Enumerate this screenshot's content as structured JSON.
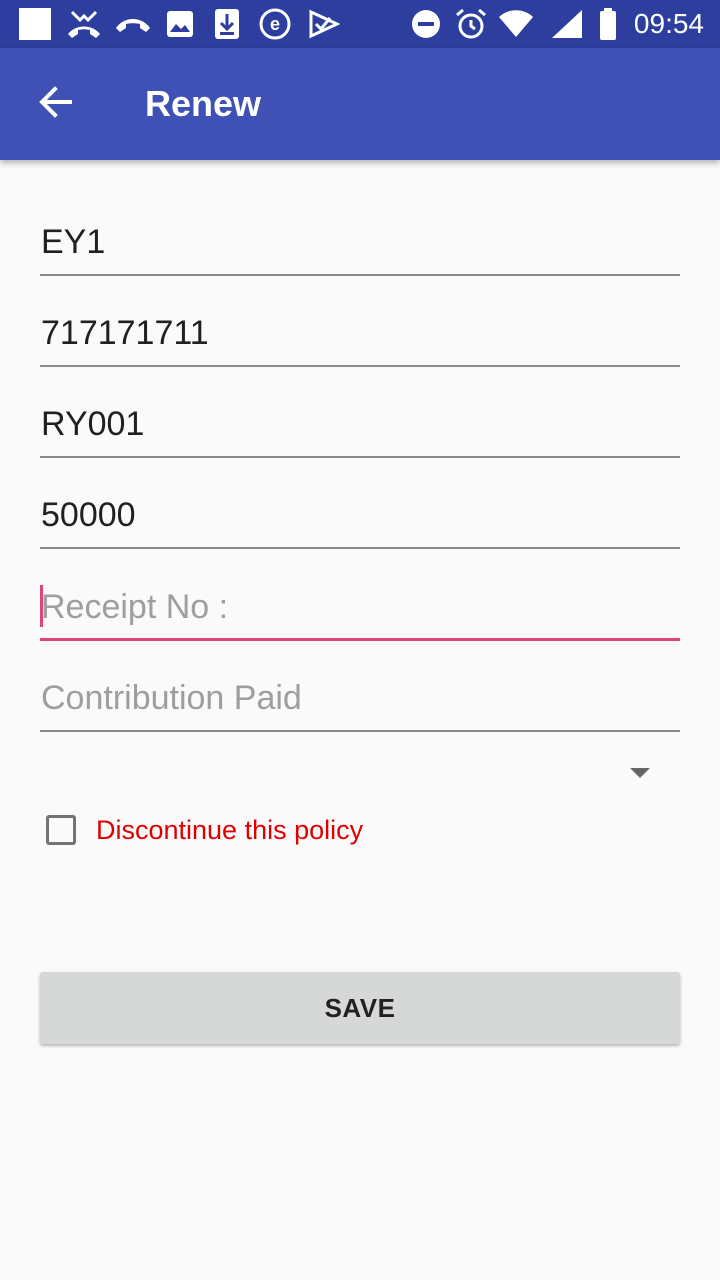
{
  "status_bar": {
    "time": "09:54",
    "icons": [
      "notification-square-icon",
      "missed-call-icon",
      "call-end-icon",
      "gallery-icon",
      "download-icon",
      "e-app-icon",
      "check-app-icon",
      "do-not-disturb-icon",
      "alarm-icon",
      "wifi-icon",
      "signal-icon",
      "battery-icon"
    ]
  },
  "app_bar": {
    "title": "Renew",
    "background": "#3f51b5",
    "back_icon": "arrow-back-icon"
  },
  "form": {
    "fields": [
      {
        "value": "EY1",
        "placeholder": ""
      },
      {
        "value": "717171711",
        "placeholder": ""
      },
      {
        "value": "RY001",
        "placeholder": ""
      },
      {
        "value": "50000",
        "placeholder": ""
      },
      {
        "value": "",
        "placeholder": "Receipt No :",
        "focused": true
      },
      {
        "value": "",
        "placeholder": "Contribution Paid"
      }
    ],
    "accent_color": "#e0447e",
    "checkbox": {
      "label": "Discontinue this policy",
      "checked": false,
      "label_color": "#e00000"
    },
    "save_label": "SAVE"
  }
}
